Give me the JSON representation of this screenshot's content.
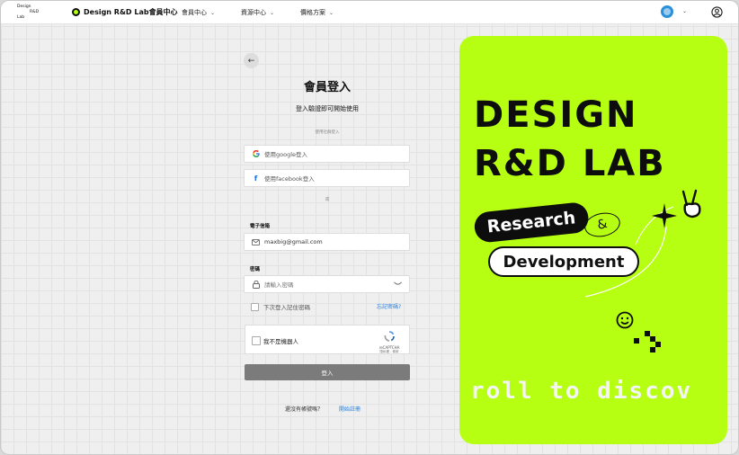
{
  "header": {
    "logo_lines": [
      "Design",
      "R&D",
      "Lab"
    ],
    "brand": "Design R&D Lab會員中心",
    "nav": [
      {
        "label": "會員中心"
      },
      {
        "label": "資源中心"
      },
      {
        "label": "價格方案"
      }
    ]
  },
  "form": {
    "back_label": "←",
    "title": "會員登入",
    "subtitle": "登入驗證即可開始使用",
    "social_caption": "使用社群登入",
    "google_label": "使用google登入",
    "facebook_label": "使用facebook登入",
    "or_label": "或",
    "email_label": "電子信箱",
    "email_value": "maxbig@gmail.com",
    "password_label": "密碼",
    "password_placeholder": "請輸入密碼",
    "remember_label": "下次登入記住密碼",
    "forgot_label": "忘記密碼?",
    "captcha_label": "我不是機器人",
    "captcha_brand": "reCAPTCHA",
    "captcha_links": "隱私權 - 條款",
    "login_button": "登入",
    "signup_prompt": "還沒有帳號嗎？",
    "signup_link": "開始註冊"
  },
  "panel": {
    "line1": "DESIGN",
    "line2": "R&D LAB",
    "pill1": "Research",
    "amp": "&",
    "pill2": "Development",
    "ticker": "roll to discov"
  },
  "colors": {
    "accent": "#b6ff12",
    "link": "#2a7fd9",
    "button": "#7b7b7b"
  }
}
